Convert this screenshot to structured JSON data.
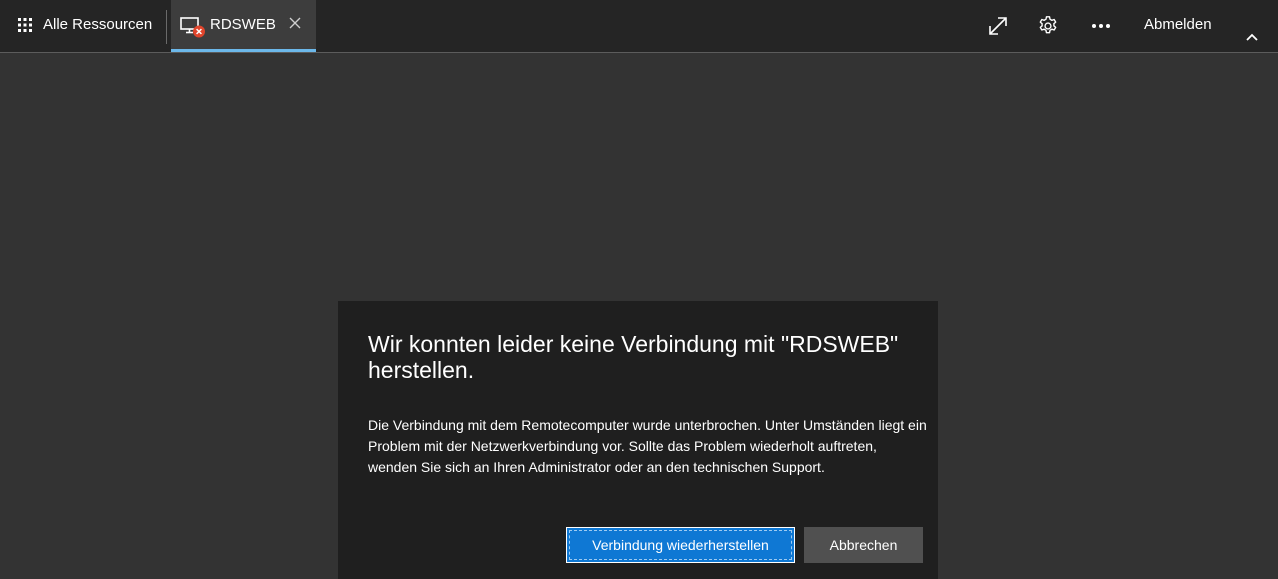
{
  "topbar": {
    "all_resources_label": "Alle Ressourcen",
    "all_resources_icon": "grid-icon",
    "tab": {
      "label": "RDSWEB",
      "icon": "pc-disconnected-icon",
      "close_icon": "close-icon",
      "accent": "#6cb8ea"
    },
    "actions": [
      {
        "name": "fullscreen-icon"
      },
      {
        "name": "gear-icon"
      },
      {
        "name": "more-icon"
      }
    ],
    "signout_label": "Abmelden",
    "collapse_icon": "chevron-up-icon"
  },
  "dialog": {
    "title": "Wir konnten leider keine Verbindung mit \"RDSWEB\" herstellen.",
    "body": "Die Verbindung mit dem Remotecomputer wurde unterbrochen. Unter Umständen liegt ein Problem mit der Netzwerkverbindung vor. Sollte das Problem wiederholt auftreten, wenden Sie sich an Ihren Administrator oder an den technischen Support.",
    "primary_button": "Verbindung wiederherstellen",
    "secondary_button": "Abbrechen",
    "primary_color": "#0f78d4"
  },
  "colors": {
    "background": "#333333",
    "topbar": "#252525",
    "dialog": "#1f1f1f",
    "error_badge": "#e0452c"
  }
}
